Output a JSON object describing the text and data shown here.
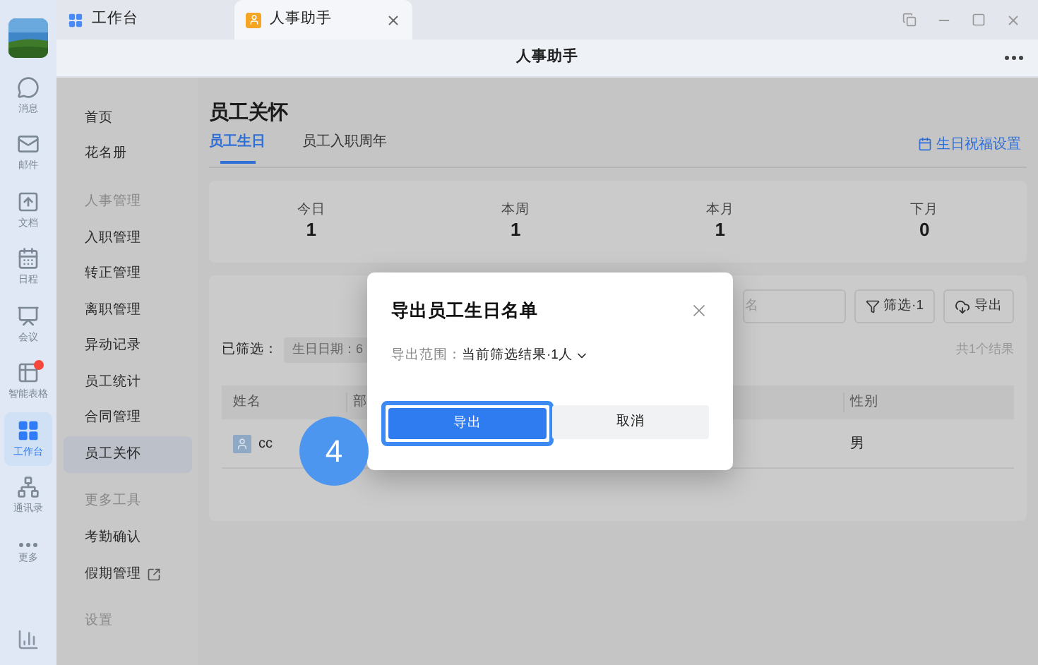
{
  "tabs": [
    {
      "label": "工作台",
      "kind": "grid",
      "selected": false
    },
    {
      "label": "人事助手",
      "kind": "app",
      "selected": true
    }
  ],
  "header": {
    "title": "人事助手"
  },
  "rail": [
    {
      "label": "消息",
      "kind": "chat",
      "selected": false,
      "badge": false
    },
    {
      "label": "邮件",
      "kind": "mail",
      "selected": false,
      "badge": false
    },
    {
      "label": "文档",
      "kind": "doc",
      "selected": false,
      "badge": false
    },
    {
      "label": "日程",
      "kind": "calendar",
      "selected": false,
      "badge": false
    },
    {
      "label": "会议",
      "kind": "meeting",
      "selected": false,
      "badge": false
    },
    {
      "label": "智能表格",
      "kind": "sheet",
      "selected": false,
      "badge": true
    },
    {
      "label": "工作台",
      "kind": "grid",
      "selected": true,
      "badge": false
    },
    {
      "label": "通讯录",
      "kind": "contacts",
      "selected": false,
      "badge": false
    },
    {
      "label": "更多",
      "kind": "more",
      "selected": false,
      "badge": false
    }
  ],
  "nav": [
    {
      "kind": "item",
      "label": "首页",
      "selected": false
    },
    {
      "kind": "item",
      "label": "花名册",
      "selected": false
    },
    {
      "kind": "section",
      "label": "人事管理"
    },
    {
      "kind": "item",
      "label": "入职管理",
      "selected": false
    },
    {
      "kind": "item",
      "label": "转正管理",
      "selected": false
    },
    {
      "kind": "item",
      "label": "离职管理",
      "selected": false
    },
    {
      "kind": "item",
      "label": "异动记录",
      "selected": false
    },
    {
      "kind": "item",
      "label": "员工统计",
      "selected": false
    },
    {
      "kind": "item",
      "label": "合同管理",
      "selected": false
    },
    {
      "kind": "item",
      "label": "员工关怀",
      "selected": true
    },
    {
      "kind": "section",
      "label": "更多工具"
    },
    {
      "kind": "item",
      "label": "考勤确认",
      "selected": false
    },
    {
      "kind": "external",
      "label": "假期管理",
      "selected": false
    },
    {
      "kind": "section",
      "label": "设置"
    }
  ],
  "page": {
    "title": "员工关怀",
    "settings_link": "生日祝福设置",
    "tabs": [
      {
        "label": "员工生日",
        "selected": true
      },
      {
        "label": "员工入职周年",
        "selected": false
      }
    ]
  },
  "stats": [
    {
      "label": "今日",
      "value": "1"
    },
    {
      "label": "本周",
      "value": "1"
    },
    {
      "label": "本月",
      "value": "1"
    },
    {
      "label": "下月",
      "value": "0"
    }
  ],
  "toolbar": {
    "search_placeholder": "名",
    "filter_button": "筛选·1",
    "export_button": "导出"
  },
  "filter": {
    "label": "已筛选：",
    "chip": "生日日期：6",
    "result_count": "共1个结果"
  },
  "table": {
    "columns": [
      "姓名",
      "部",
      "性别"
    ],
    "rows": [
      {
        "name": "cc",
        "gender": "男"
      }
    ]
  },
  "dialog": {
    "title": "导出员工生日名单",
    "scope_label": "导出范围：",
    "scope_value": "当前筛选结果·1人",
    "primary": "导出",
    "secondary": "取消"
  },
  "step_badge": "4"
}
